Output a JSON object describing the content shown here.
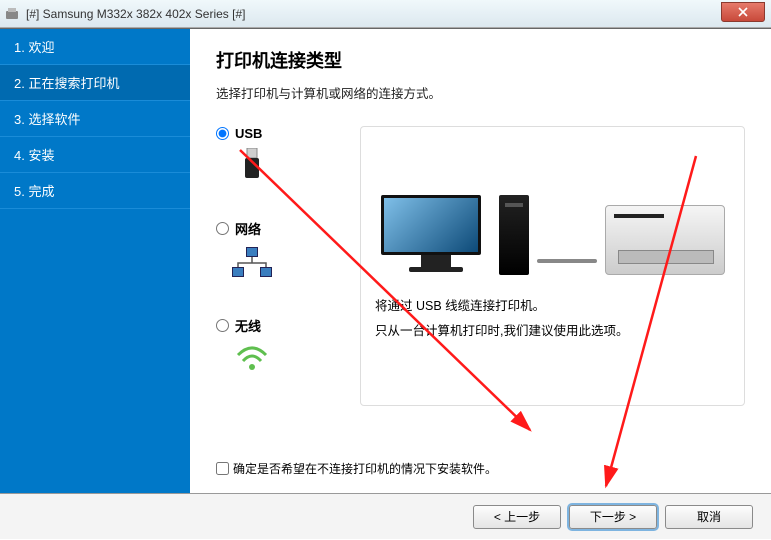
{
  "titlebar": {
    "text": "[#] Samsung M332x 382x 402x Series [#]"
  },
  "sidebar": {
    "items": [
      {
        "label": "1. 欢迎"
      },
      {
        "label": "2. 正在搜索打印机"
      },
      {
        "label": "3. 选择软件"
      },
      {
        "label": "4. 安装"
      },
      {
        "label": "5. 完成"
      }
    ],
    "active_index": 1
  },
  "main": {
    "title": "打印机连接类型",
    "subtitle": "选择打印机与计算机或网络的连接方式。",
    "options": {
      "usb": "USB",
      "network": "网络",
      "wireless": "无线"
    },
    "selected": "usb",
    "desc1": "将通过 USB 线缆连接打印机。",
    "desc2": "只从一台计算机打印时,我们建议使用此选项。",
    "checkbox": "确定是否希望在不连接打印机的情况下安装软件。"
  },
  "footer": {
    "back": "< 上一步",
    "next": "下一步 >",
    "cancel": "取消"
  }
}
